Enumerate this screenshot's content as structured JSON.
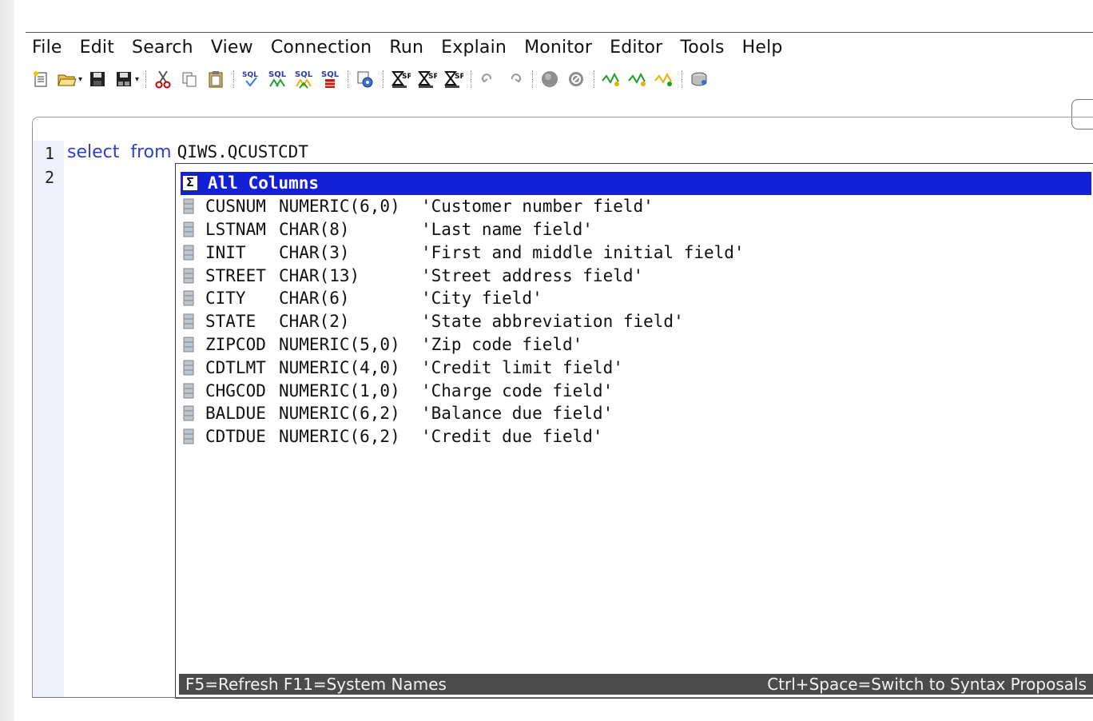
{
  "menubar": {
    "items": [
      "File",
      "Edit",
      "Search",
      "View",
      "Connection",
      "Run",
      "Explain",
      "Monitor",
      "Editor",
      "Tools",
      "Help"
    ]
  },
  "toolbar": {
    "icons": [
      "new-file-icon",
      "open-folder-icon",
      "save-icon",
      "save-as-icon",
      "cut-icon",
      "copy-icon",
      "paste-icon",
      "sql-check-icon",
      "sql-run-icon",
      "sql-run-all-icon",
      "sql-stop-icon",
      "settings-icon",
      "explain-icon",
      "explain-run-icon",
      "explain-all-icon",
      "undo-icon",
      "redo-icon",
      "stop-circle-icon",
      "cancel-icon",
      "monitor-1-icon",
      "monitor-2-icon",
      "monitor-3-icon",
      "database-icon"
    ],
    "sql_label": "SQL"
  },
  "editor": {
    "lines": [
      {
        "number": "1",
        "keyword1": "select",
        "keyword2": "from",
        "table": "QIWS.QCUSTCDT"
      },
      {
        "number": "2"
      }
    ]
  },
  "popup": {
    "all_columns": "All Columns",
    "columns": [
      {
        "name": "CUSNUM",
        "type": "NUMERIC(6,0)",
        "desc": "'Customer number field'"
      },
      {
        "name": "LSTNAM",
        "type": "CHAR(8)",
        "desc": "'Last name field'"
      },
      {
        "name": "INIT",
        "type": "CHAR(3)",
        "desc": "'First and middle initial field'"
      },
      {
        "name": "STREET",
        "type": "CHAR(13)",
        "desc": "'Street address field'"
      },
      {
        "name": "CITY",
        "type": "CHAR(6)",
        "desc": "'City field'"
      },
      {
        "name": "STATE",
        "type": "CHAR(2)",
        "desc": "'State abbreviation field'"
      },
      {
        "name": "ZIPCOD",
        "type": "NUMERIC(5,0)",
        "desc": "'Zip code field'"
      },
      {
        "name": "CDTLMT",
        "type": "NUMERIC(4,0)",
        "desc": "'Credit limit field'"
      },
      {
        "name": "CHGCOD",
        "type": "NUMERIC(1,0)",
        "desc": "'Charge code field'"
      },
      {
        "name": "BALDUE",
        "type": "NUMERIC(6,2)",
        "desc": "'Balance due field'"
      },
      {
        "name": "CDTDUE",
        "type": "NUMERIC(6,2)",
        "desc": "'Credit due field'"
      }
    ],
    "status_left": "F5=Refresh F11=System Names",
    "status_right": "Ctrl+Space=Switch to Syntax Proposals"
  },
  "colors": {
    "selection": "#1420d6",
    "keyword": "#2c3fd0",
    "status_bar": "#4b4b4b"
  }
}
